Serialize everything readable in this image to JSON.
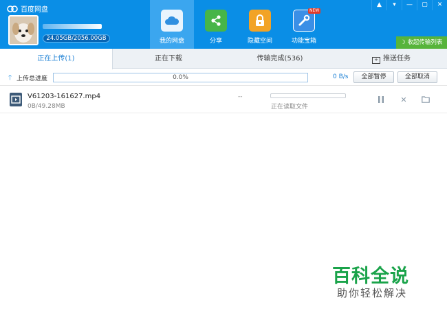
{
  "app": {
    "title": "百度网盘",
    "quota": "24.05GB/2056.00GB"
  },
  "nav": [
    {
      "label": "我的网盘",
      "icon": "cloud-icon",
      "active": true,
      "color": "#2f8fe0"
    },
    {
      "label": "分享",
      "icon": "share-icon",
      "active": false,
      "color": "#47b548"
    },
    {
      "label": "隐藏空间",
      "icon": "lock-icon",
      "active": false,
      "color": "#f2a326"
    },
    {
      "label": "功能宝箱",
      "icon": "toolbox-icon",
      "active": false,
      "color": "#3b8fe6",
      "badge": "NEW"
    }
  ],
  "window": {
    "collapse_label": "收起传输列表"
  },
  "tabs": [
    {
      "label": "正在上传(1)",
      "active": true
    },
    {
      "label": "正在下载",
      "active": false
    },
    {
      "label": "传输完成(536)",
      "active": false
    },
    {
      "label": "推送任务",
      "active": false
    }
  ],
  "overall": {
    "label": "上传总进度",
    "percent_text": "0.0%",
    "percent": 0,
    "speed": "0 B/s",
    "pause_all": "全部暂停",
    "cancel_all": "全部取消"
  },
  "files": [
    {
      "name": "V61203-161627.mp4",
      "size": "0B/49.28MB",
      "eta": "--",
      "status": "正在读取文件",
      "progress": 0
    }
  ],
  "watermark": {
    "title": "百科全说",
    "subtitle": "助你轻松解决"
  }
}
